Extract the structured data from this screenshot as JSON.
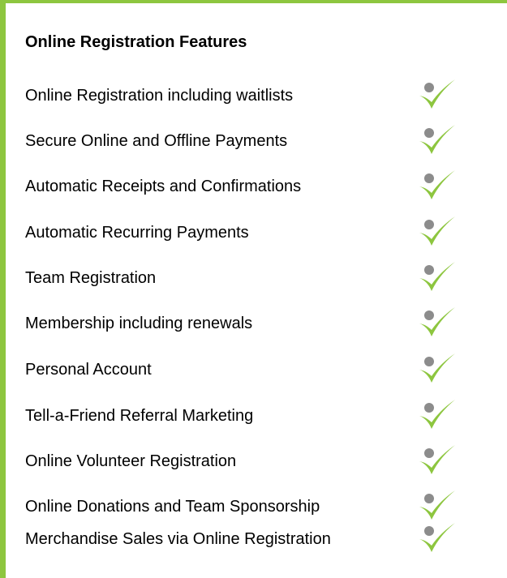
{
  "title": "Online Registration Features",
  "features": [
    {
      "label": "Online Registration including waitlists",
      "checked": true
    },
    {
      "label": "Secure Online and Offline Payments",
      "checked": true
    },
    {
      "label": "Automatic Receipts and Confirmations",
      "checked": true
    },
    {
      "label": "Automatic Recurring Payments",
      "checked": true
    },
    {
      "label": "Team Registration",
      "checked": true
    },
    {
      "label": "Membership including renewals",
      "checked": true
    },
    {
      "label": "Personal Account",
      "checked": true
    },
    {
      "label": "Tell-a-Friend Referral Marketing",
      "checked": true
    },
    {
      "label": "Online Volunteer Registration",
      "checked": true
    },
    {
      "label": "Online Donations and Team Sponsorship",
      "checked": true
    },
    {
      "label": "Merchandise Sales via Online Registration",
      "checked": true
    }
  ],
  "colors": {
    "accent_border": "#8DC63F",
    "check_green": "#8DC63F",
    "check_dot": "#8C8C8C",
    "text": "#000000"
  },
  "icons": {
    "feature_check": "checkmark-with-dot-icon"
  }
}
